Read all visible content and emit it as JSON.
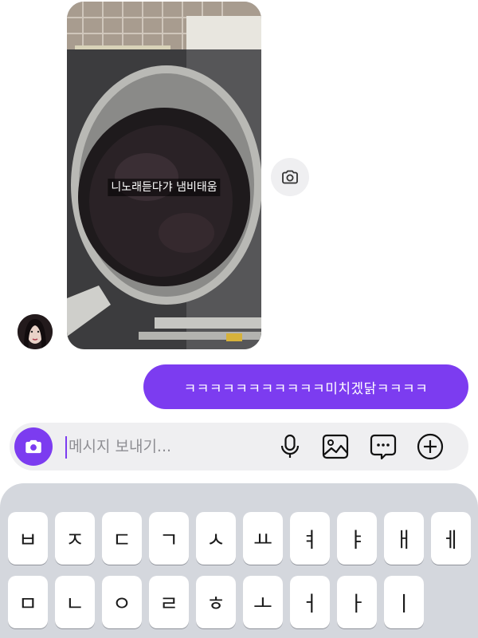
{
  "thread": {
    "received_photo": {
      "caption": "니노래듣다갸 냄비태움"
    },
    "sent_message": {
      "text": "ㅋㅋㅋㅋㅋㅋㅋㅋㅋㅋㅋ미치겠닭ㅋㅋㅋㅋ"
    },
    "icons": {
      "share_photo": "camera-icon",
      "avatar": "profile-avatar"
    }
  },
  "composer": {
    "placeholder": "메시지 보내기...",
    "value": "",
    "icons": [
      "camera-icon",
      "microphone-icon",
      "gallery-icon",
      "sticker-icon",
      "plus-icon"
    ],
    "accent_color": "#7c3cf0"
  },
  "keyboard": {
    "row1": [
      "ㅂ",
      "ㅈ",
      "ㄷ",
      "ㄱ",
      "ㅅ",
      "ㅛ",
      "ㅕ",
      "ㅑ",
      "ㅐ",
      "ㅔ"
    ],
    "row2": [
      "ㅁ",
      "ㄴ",
      "ㅇ",
      "ㄹ",
      "ㅎ",
      "ㅗ",
      "ㅓ",
      "ㅏ",
      "ㅣ"
    ]
  }
}
